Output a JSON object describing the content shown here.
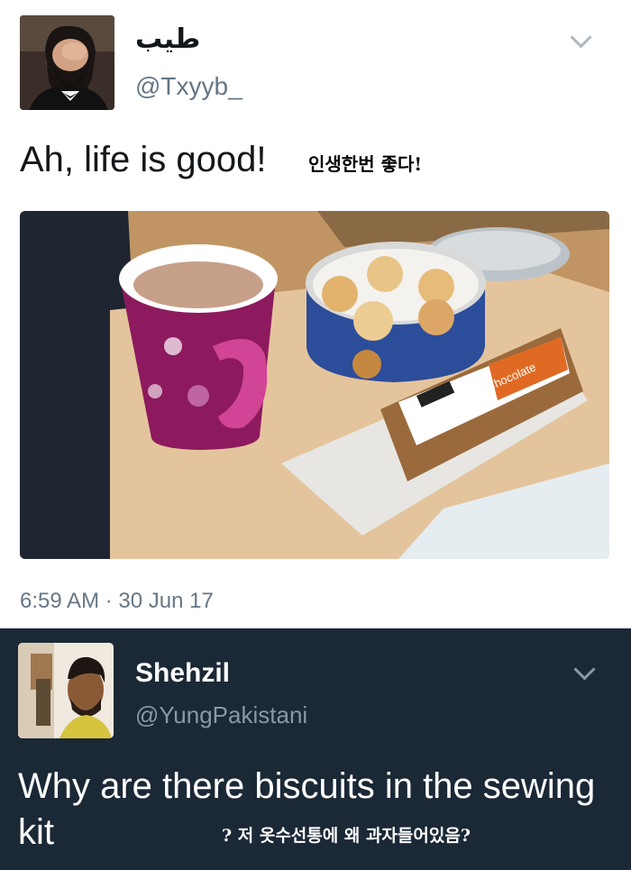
{
  "tweet": {
    "display_name": "طيب",
    "handle": "@Txyyb_",
    "text": "Ah, life is good!",
    "translation": "인생한번 좋다!",
    "timestamp": "6:59 AM · 30 Jun 17"
  },
  "reply": {
    "display_name": "Shehzil",
    "handle": "@YungPakistani",
    "text": "Why are there biscuits in the sewing kit",
    "translation": "? 저 옷수선통에 왜 과자들어있음?"
  },
  "photo": {
    "product_label": "Chocolate"
  },
  "icons": {
    "menu": "chevron-down-icon"
  },
  "colors": {
    "reply_background": "#1b2836",
    "secondary_text": "#657786"
  }
}
